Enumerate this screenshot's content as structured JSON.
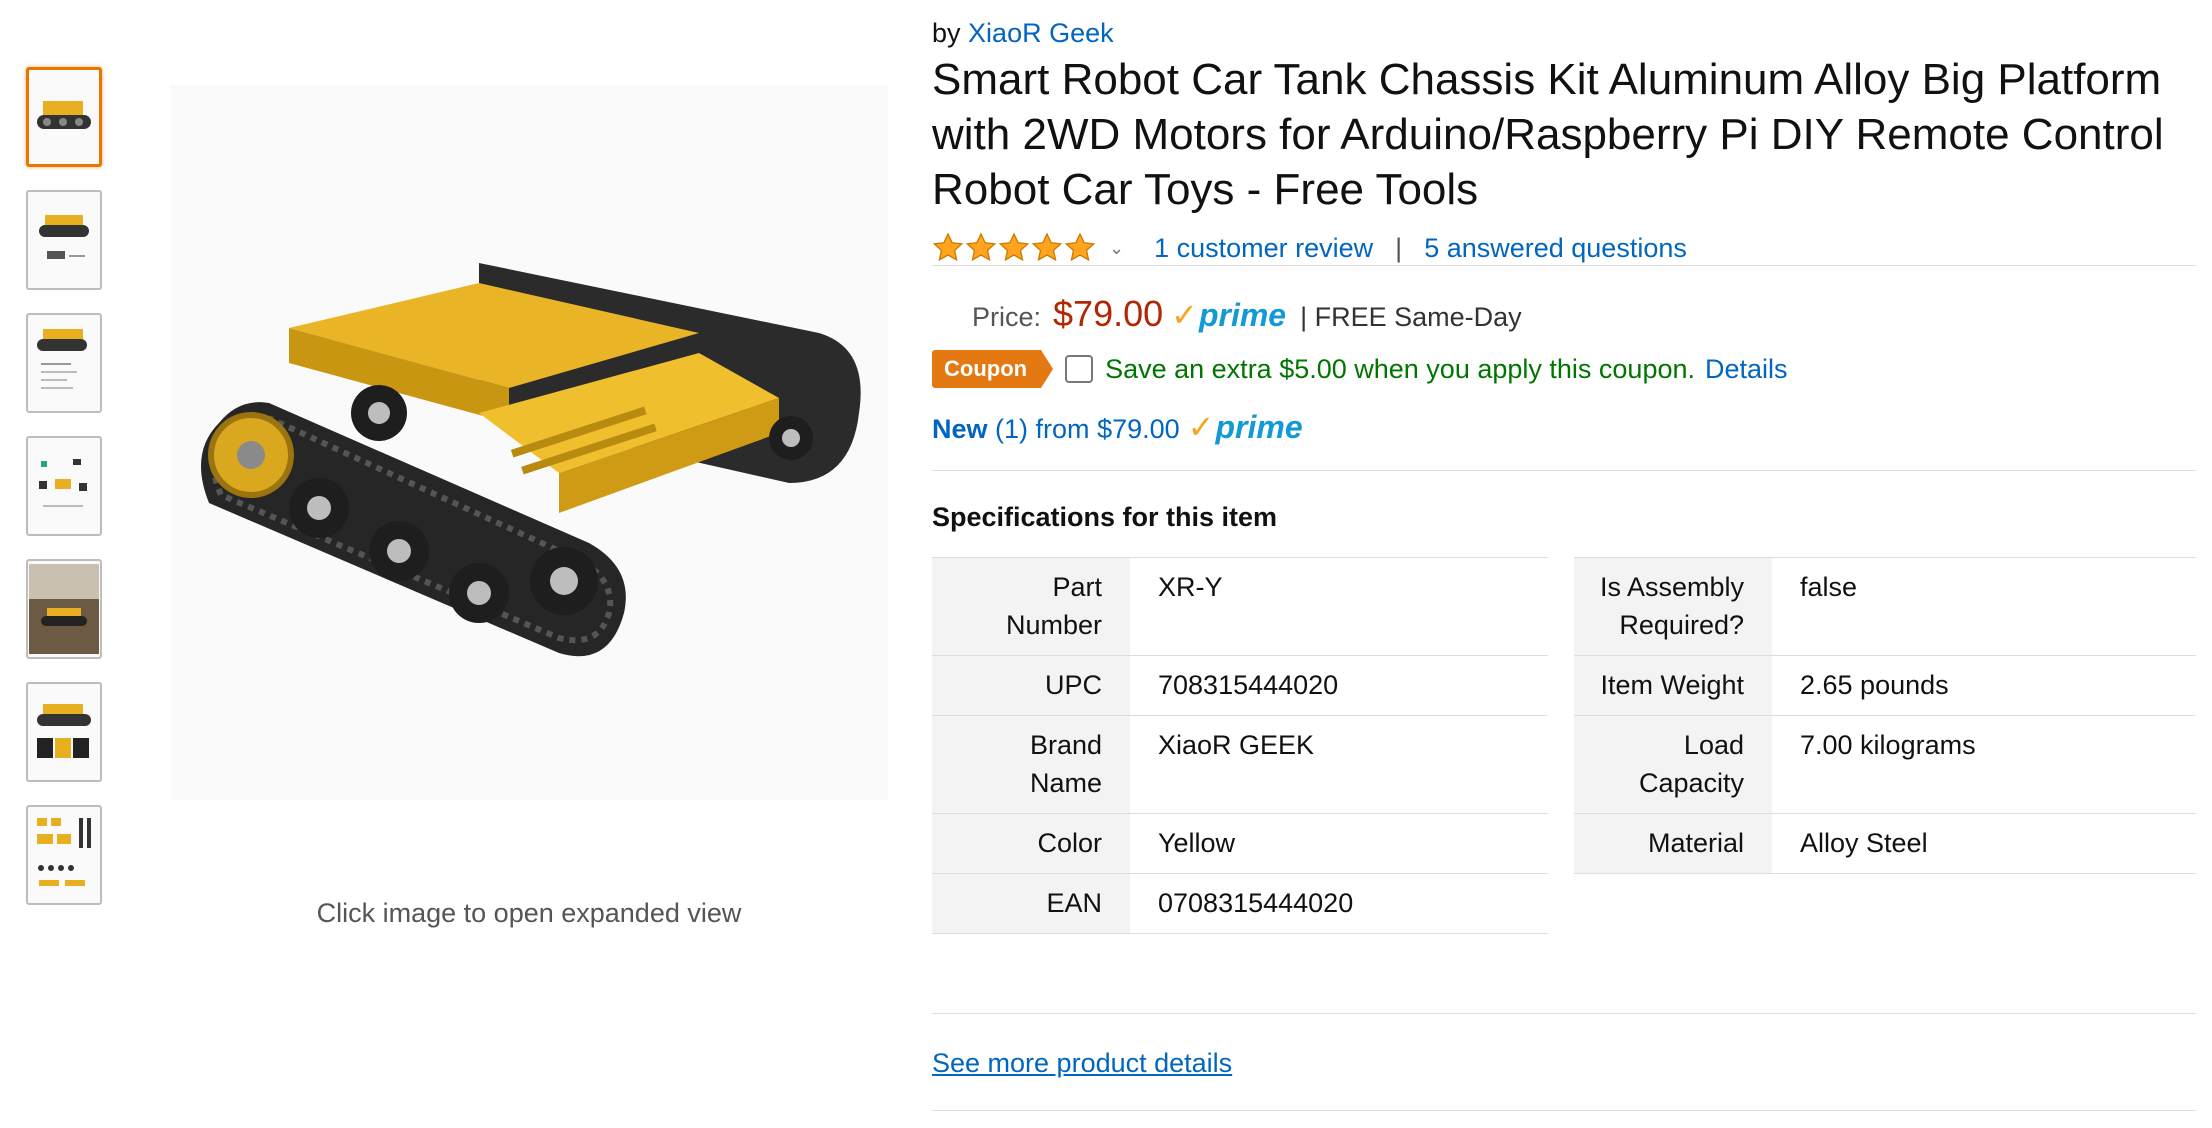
{
  "brand_line": {
    "prefix": "by",
    "brand": "XiaoR Geek"
  },
  "title": "Smart Robot Car Tank Chassis Kit Aluminum Alloy Big Platform with 2WD Motors for Arduino/Raspberry Pi DIY Remote Control Robot Car Toys - Free Tools",
  "rating": {
    "stars": 5,
    "max": 5,
    "reviews_link": "1 customer review",
    "separator": "|",
    "questions_link": "5 answered questions"
  },
  "price": {
    "label": "Price:",
    "value": "$79.00",
    "prime": "prime",
    "shipping": "| FREE Same-Day"
  },
  "coupon": {
    "badge": "Coupon",
    "text": "Save an extra $5.00 when you apply this coupon.",
    "details": "Details"
  },
  "offers": {
    "new_label": "New",
    "count": "(1) from",
    "price": "$79.00",
    "prime": "prime"
  },
  "image": {
    "caption": "Click image to open expanded view"
  },
  "specs": {
    "title": "Specifications for this item",
    "left": [
      {
        "key": "Part Number",
        "value": "XR-Y"
      },
      {
        "key": "UPC",
        "value": "708315444020"
      },
      {
        "key": "Brand Name",
        "value": "XiaoR GEEK"
      },
      {
        "key": "Color",
        "value": "Yellow"
      },
      {
        "key": "EAN",
        "value": "0708315444020"
      }
    ],
    "right": [
      {
        "key": "Is Assembly Required?",
        "value": "false"
      },
      {
        "key": "Item Weight",
        "value": "2.65  pounds"
      },
      {
        "key": "Load Capacity",
        "value": "7.00  kilograms"
      },
      {
        "key": "Material",
        "value": "Alloy Steel"
      }
    ]
  },
  "see_more": "See more product details",
  "colors": {
    "link": "#0066c0",
    "price": "#b12704",
    "coupon_green": "#007600",
    "badge_orange": "#e47911",
    "prime_blue": "#1399d6",
    "star": "#ffa41c"
  }
}
